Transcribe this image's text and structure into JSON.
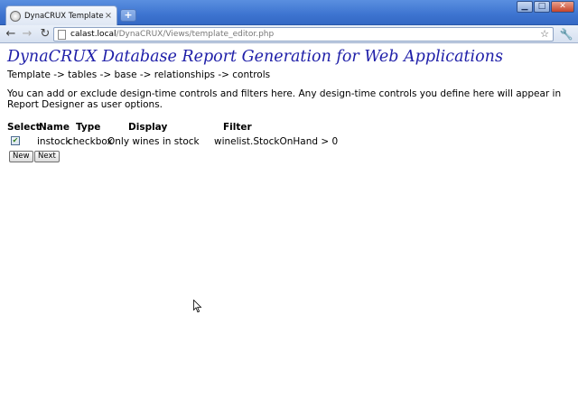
{
  "browser": {
    "tab_title": "DynaCRUX Template Editor",
    "tab_close": "×",
    "new_tab": "+",
    "window_buttons": {
      "minimize": "▁",
      "maximize": "□",
      "close": "✕"
    },
    "nav": {
      "back": "←",
      "forward": "→",
      "reload": "↻"
    },
    "url_host": "calast.local",
    "url_path": "/DynaCRUX/Views/template_editor.php",
    "star": "☆",
    "wrench": "🔧"
  },
  "page": {
    "title": "DynaCRUX Database Report Generation for Web Applications",
    "breadcrumb": "Template -> tables -> base -> relationships -> controls",
    "intro": "You can add or exclude design-time controls and filters here. Any design-time controls you define here will appear in Report Designer as user options."
  },
  "controls_table": {
    "headers": {
      "select": "Select",
      "name": "Name",
      "type": "Type",
      "display": "Display",
      "filter": "Filter"
    },
    "rows": [
      {
        "checked": true,
        "check_mark": "✔",
        "name": "instock",
        "type": "checkbox",
        "display": "Only wines in stock",
        "filter": "winelist.StockOnHand > 0"
      }
    ]
  },
  "buttons": {
    "new": "New",
    "next": "Next"
  },
  "icons": {
    "favicon": "globe-icon",
    "page": "page-icon",
    "cursor": "mouse-pointer-icon"
  }
}
